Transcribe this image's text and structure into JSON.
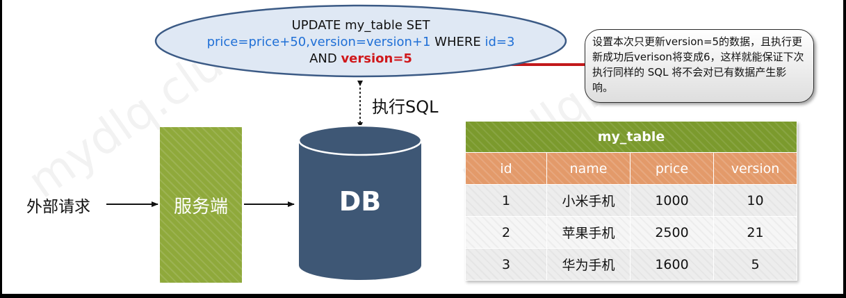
{
  "sql": {
    "line1": "UPDATE my_table SET",
    "line2_set": "price=price+50,version=version+1",
    "line2_where": " WHERE ",
    "line2_id": "id=3",
    "line3_and": "AND ",
    "line3_version": "version=5"
  },
  "note": {
    "text": "设置本次只更新version=5的数据，且执行更新成功后verison将变成6，这样就能保证下次执行同样的 SQL 将不会对已有数据产生影响。"
  },
  "exec_label": "执行SQL",
  "external_label": "外部请求",
  "service_label": "服务端",
  "db_label": "DB",
  "watermark": "mydlq.club",
  "table": {
    "title": "my_table",
    "columns": [
      "id",
      "name",
      "price",
      "version"
    ],
    "rows": [
      [
        "1",
        "小米手机",
        "1000",
        "10"
      ],
      [
        "2",
        "苹果手机",
        "2500",
        "21"
      ],
      [
        "3",
        "华为手机",
        "1600",
        "5"
      ]
    ]
  },
  "colors": {
    "ellipse_fill": "#dfe8f4",
    "ellipse_stroke": "#3b5a85",
    "blue_text": "#1f6fd6",
    "red_text": "#d0181b",
    "service_fill": "#8fa93b",
    "db_fill": "#3e5775",
    "table_title": "#7b9a2d",
    "table_header": "#e39a6a"
  }
}
